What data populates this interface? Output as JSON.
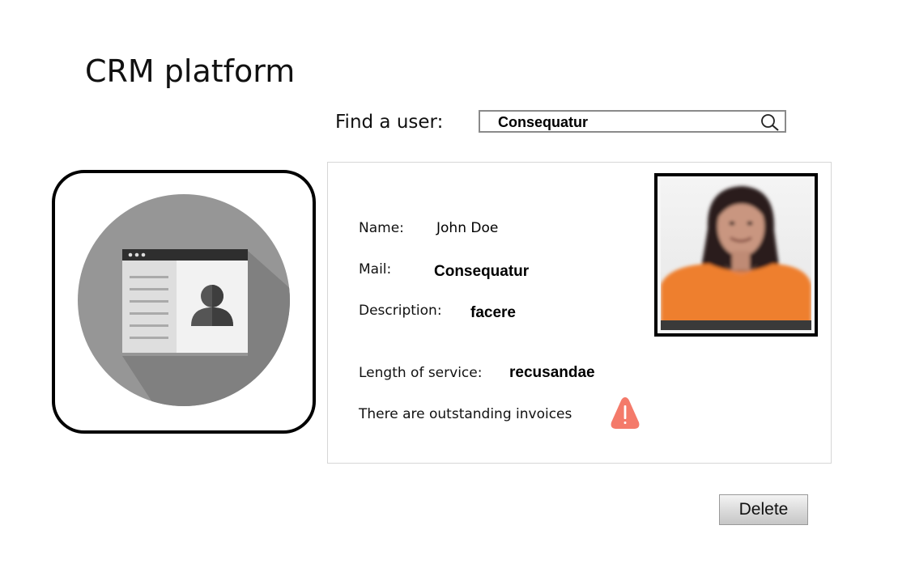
{
  "app": {
    "title": "CRM platform"
  },
  "search": {
    "label": "Find a user:",
    "value": "Consequatur",
    "icon": "search-icon"
  },
  "app_icon": {
    "icon": "contact-card-icon",
    "background_color": "#8c8c8c"
  },
  "user": {
    "name_label": "Name:",
    "name_value": "John Doe",
    "mail_label": "Mail:",
    "mail_value": "Consequatur",
    "description_label": "Description:",
    "description_value": "facere",
    "service_label": "Length of service:",
    "service_value": "recusandae",
    "invoices_text": "There are outstanding invoices",
    "warning_icon": "warning-icon",
    "warning_color": "#f47a6a",
    "photo": "user-photo"
  },
  "actions": {
    "delete_label": "Delete"
  }
}
